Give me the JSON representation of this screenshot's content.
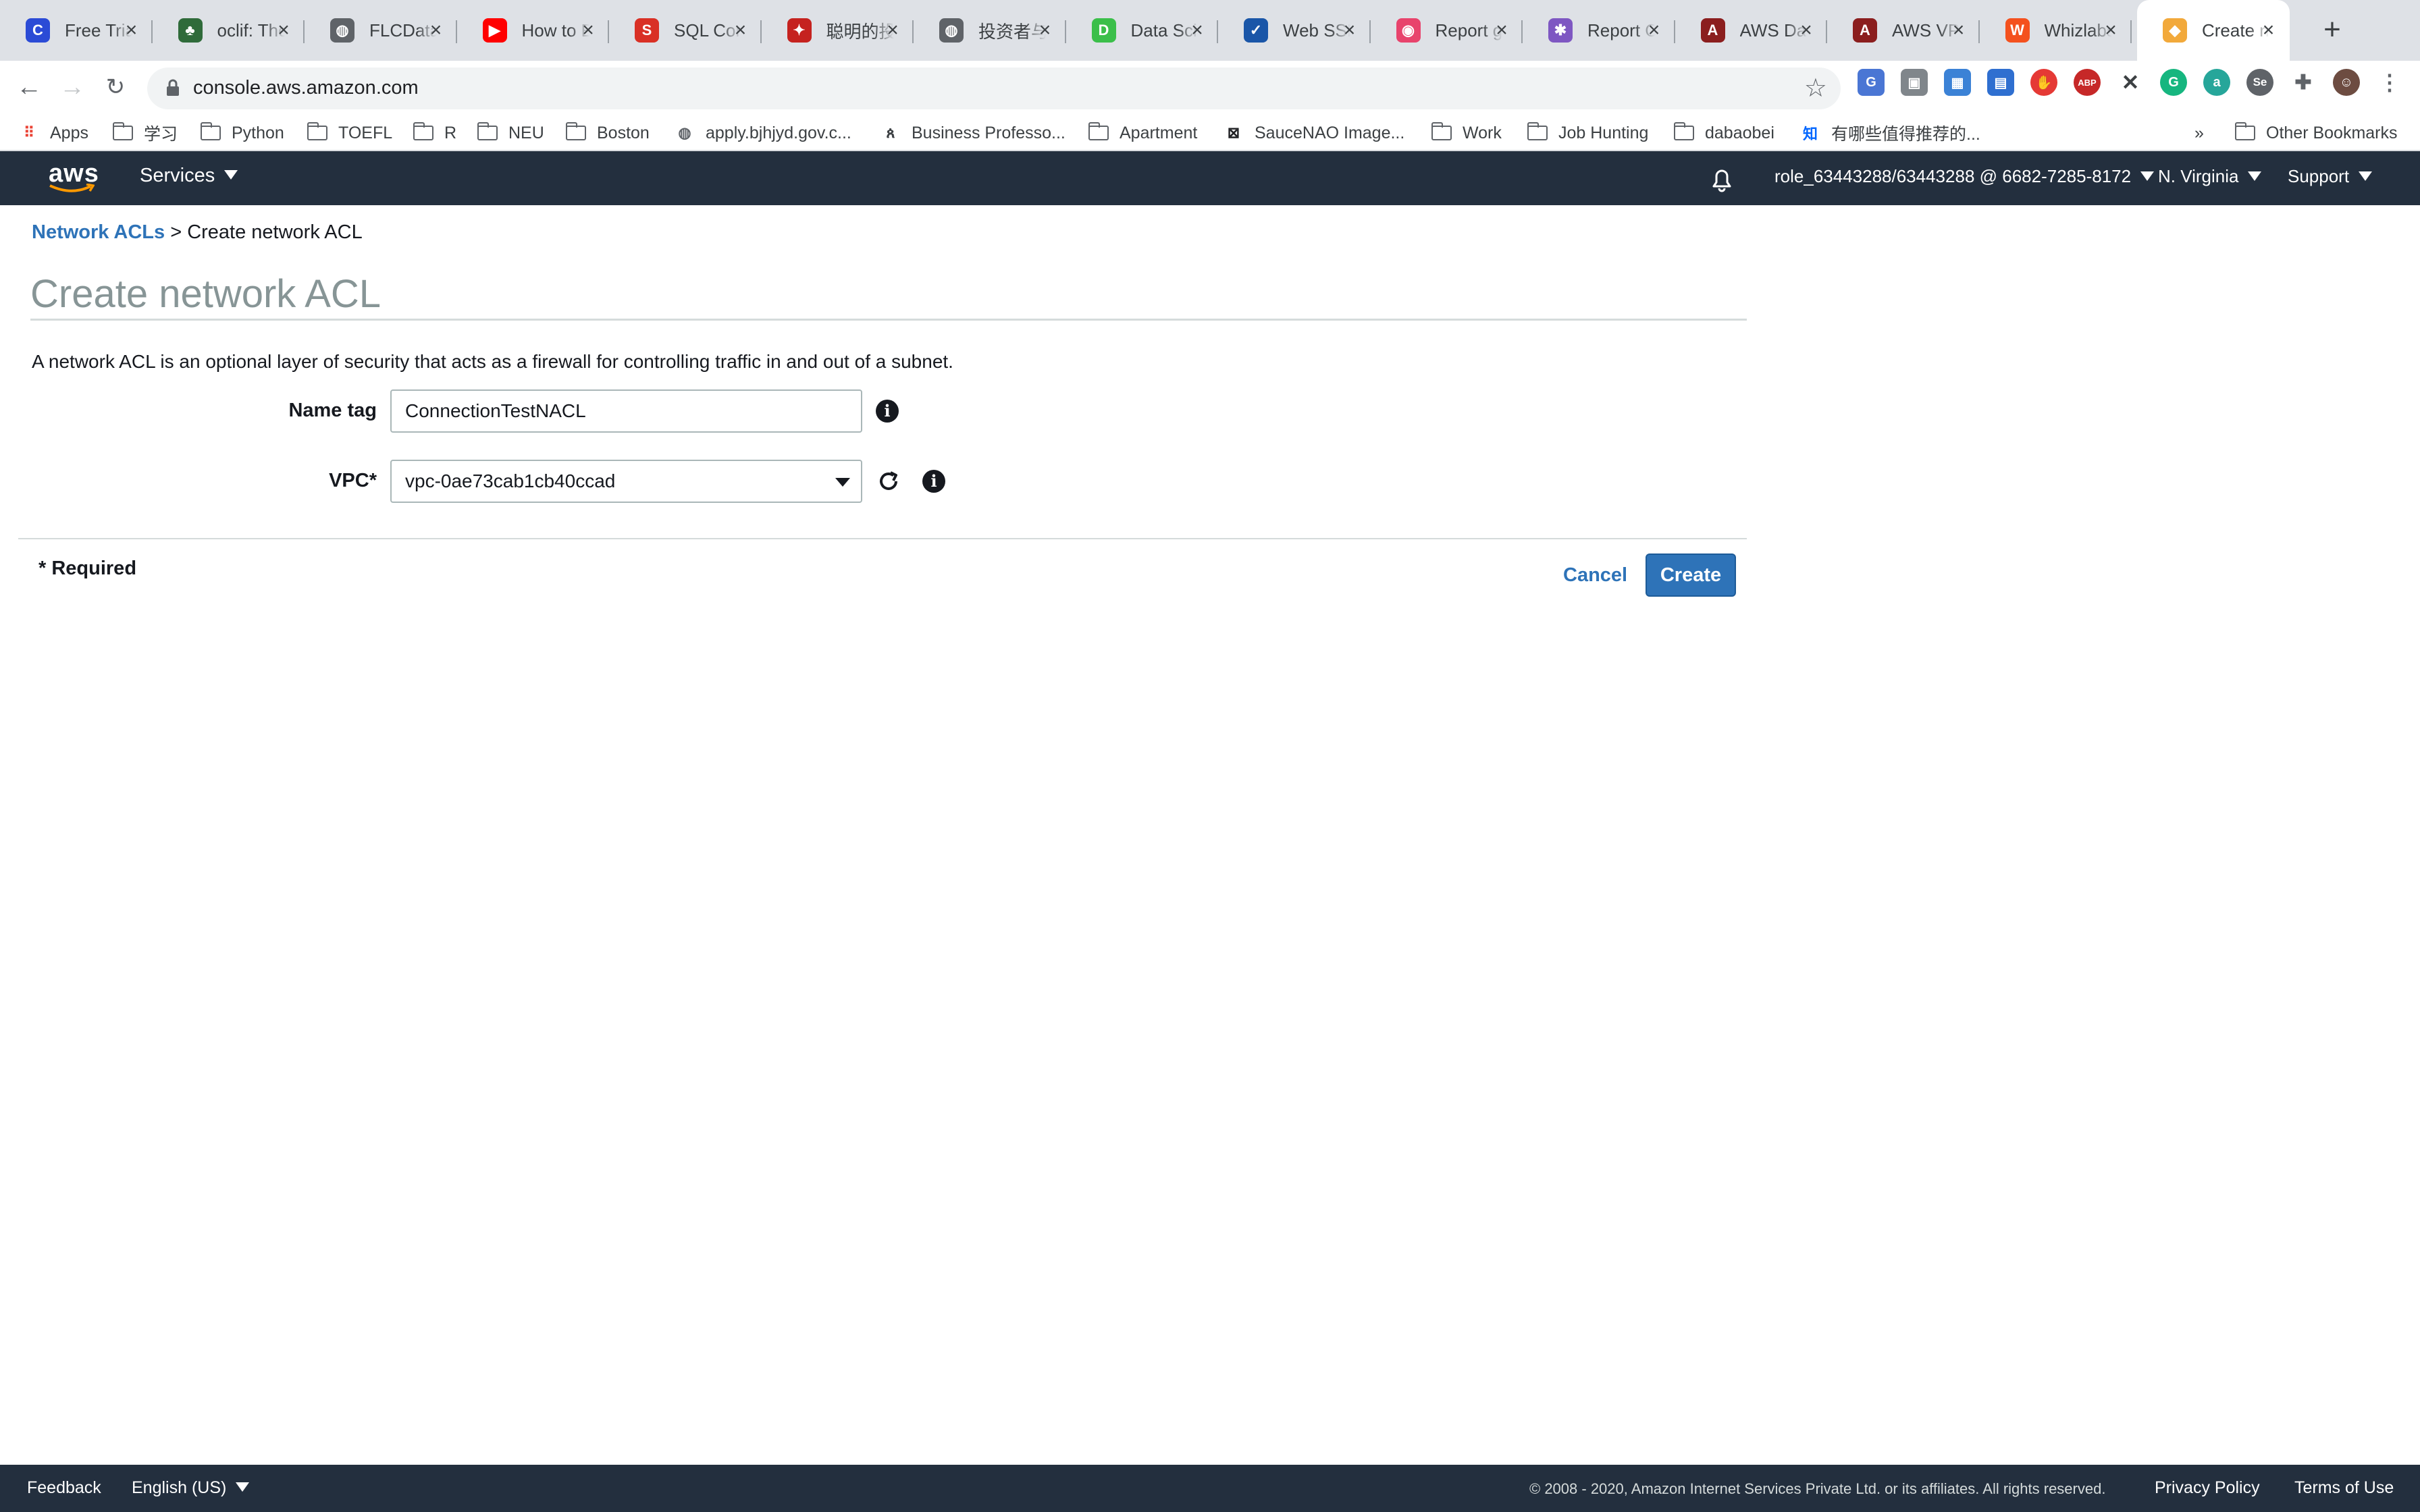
{
  "browser": {
    "tabs": [
      {
        "title": "Free Trial",
        "fav": "C",
        "color": "#2b4bd6"
      },
      {
        "title": "oclif: The",
        "fav": "♣",
        "color": "#2f6b3a"
      },
      {
        "title": "FLCData",
        "fav": "◍",
        "color": "#5f6368"
      },
      {
        "title": "How to E",
        "fav": "▶",
        "color": "#ff0000"
      },
      {
        "title": "SQL Con",
        "fav": "S",
        "color": "#d93025"
      },
      {
        "title": "聪明的投",
        "fav": "✦",
        "color": "#c5221f"
      },
      {
        "title": "投资者与",
        "fav": "◍",
        "color": "#5f6368"
      },
      {
        "title": "Data Sci",
        "fav": "D",
        "color": "#3bbf4a"
      },
      {
        "title": "Web SSR",
        "fav": "✓",
        "color": "#1a56a8"
      },
      {
        "title": "Report g",
        "fav": "◉",
        "color": "#e8436c"
      },
      {
        "title": "Report C",
        "fav": "✱",
        "color": "#7e57c2"
      },
      {
        "title": "AWS Dat",
        "fav": "A",
        "color": "#8b1e1e"
      },
      {
        "title": "AWS VPC",
        "fav": "A",
        "color": "#8b1e1e"
      },
      {
        "title": "Whizlabs",
        "fav": "W",
        "color": "#f4511e"
      },
      {
        "title": "Create n",
        "fav": "◆",
        "color": "#f2a93b",
        "active": true
      }
    ],
    "url": "console.aws.amazon.com",
    "bookmarks": [
      {
        "label": "Apps",
        "type": "apps"
      },
      {
        "label": "学习",
        "type": "folder"
      },
      {
        "label": "Python",
        "type": "folder"
      },
      {
        "label": "TOEFL",
        "type": "folder"
      },
      {
        "label": "R",
        "type": "folder"
      },
      {
        "label": "NEU",
        "type": "folder"
      },
      {
        "label": "Boston",
        "type": "folder"
      },
      {
        "label": "apply.bjhjyd.gov.c...",
        "type": "globe"
      },
      {
        "label": "Business Professo...",
        "type": "person"
      },
      {
        "label": "Apartment",
        "type": "folder"
      },
      {
        "label": "SauceNAO Image...",
        "type": "sauce"
      },
      {
        "label": "Work",
        "type": "folder"
      },
      {
        "label": "Job Hunting",
        "type": "folder"
      },
      {
        "label": "dabaobei",
        "type": "folder"
      },
      {
        "label": "有哪些值得推荐的...",
        "type": "zhihu"
      }
    ],
    "bookmarks_more": "»",
    "other_bookmarks": "Other Bookmarks"
  },
  "aws_nav": {
    "logo": "aws",
    "services": "Services",
    "account": "role_63443288/63443288 @ 6682-7285-8172",
    "region": "N. Virginia",
    "support": "Support"
  },
  "breadcrumb": {
    "link": "Network ACLs",
    "separator": ">",
    "current": "Create network ACL"
  },
  "page": {
    "title": "Create network ACL",
    "description": "A network ACL is an optional layer of security that acts as a firewall for controlling traffic in and out of a subnet."
  },
  "form": {
    "name_tag_label": "Name tag",
    "name_tag_value": "ConnectionTestNACL",
    "vpc_label": "VPC*",
    "vpc_value": "vpc-0ae73cab1cb40ccad",
    "required_note": "* Required",
    "cancel": "Cancel",
    "create": "Create"
  },
  "footer": {
    "feedback": "Feedback",
    "language": "English (US)",
    "copyright": "© 2008 - 2020, Amazon Internet Services Private Ltd. or its affiliates. All rights reserved.",
    "privacy": "Privacy Policy",
    "terms": "Terms of Use"
  },
  "colors": {
    "aws_nav_bg": "#232f3e",
    "link_blue": "#2e73b8",
    "primary_button": "#2e73b8"
  }
}
